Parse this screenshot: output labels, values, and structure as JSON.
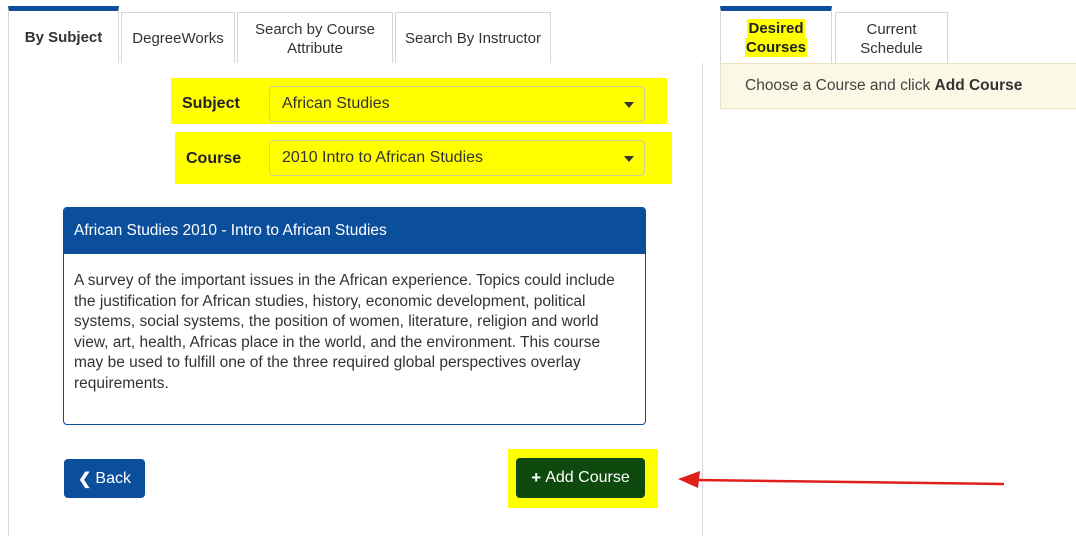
{
  "tabs": [
    {
      "label": "By Subject"
    },
    {
      "label": "DegreeWorks"
    },
    {
      "label_line1": "Search by Course",
      "label_line2": "Attribute"
    },
    {
      "label": "Search By Instructor"
    }
  ],
  "form": {
    "subject_label": "Subject",
    "subject_value": "African Studies",
    "course_label": "Course",
    "course_value": "2010 Intro to African Studies"
  },
  "card": {
    "title": "African Studies 2010 - Intro to African Studies",
    "description": "A survey of the important issues in the African experience. Topics could include the justification for African studies, history, economic development, political systems, social systems, the position of women, literature, religion and world view, art, health, Africas place in the world, and the environment. This course may be used to fulfill one of the three required global perspectives overlay requirements."
  },
  "buttons": {
    "back_label": "Back",
    "add_label": "Add Course"
  },
  "right_tabs": {
    "desired_line1": "Desired",
    "desired_line2": "Courses",
    "current_line1": "Current",
    "current_line2": "Schedule"
  },
  "right_panel": {
    "message_prefix": "Choose a Course and click ",
    "message_bold": "Add Course"
  },
  "colors": {
    "primary": "#0b4f9c",
    "success": "#0e4a0e",
    "highlight": "#ffff00",
    "annotation_arrow": "#e0201b"
  }
}
